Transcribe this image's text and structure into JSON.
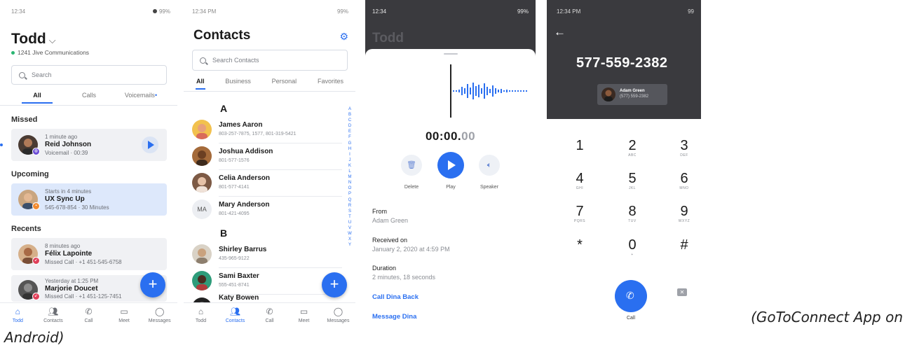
{
  "screen_home": {
    "status_time": "12:34",
    "status_right": "99%",
    "title": "Todd",
    "org": "1241 Jive Communications",
    "search_placeholder": "Search",
    "tabs": [
      "All",
      "Calls",
      "Voicemails"
    ],
    "voicemail_dot": "•",
    "missed_header": "Missed",
    "missed": {
      "time": "1 minute ago",
      "name": "Reid Johnson",
      "detail": "Voicemail · 00:39"
    },
    "upcoming_header": "Upcoming",
    "upcoming": {
      "time": "Starts in 4 minutes",
      "name": "UX Sync Up",
      "detail": "545-678-854 · 30 Minutes"
    },
    "recents_header": "Recents",
    "recents": [
      {
        "time": "8 minutes ago",
        "name": "Félix Lapointe",
        "detail": "Missed Call · +1 451-545-6758"
      },
      {
        "time": "Yesterday at 1:25 PM",
        "name": "Marjorie Doucet",
        "detail": "Missed Call · +1 451-125-7451"
      }
    ],
    "fab": "+",
    "nav": [
      "Todd",
      "Contacts",
      "Call",
      "Meet",
      "Messages"
    ]
  },
  "screen_contacts": {
    "status_time": "12:34 PM",
    "status_right": "99%",
    "title": "Contacts",
    "search_placeholder": "Search Contacts",
    "tabs": [
      "All",
      "Business",
      "Personal",
      "Favorites"
    ],
    "group_a": "A",
    "group_b": "B",
    "contacts_a": [
      {
        "name": "James Aaron",
        "phone": "803-257-7875, 1577, 801-319-5421"
      },
      {
        "name": "Joshua Addison",
        "phone": "801-577-1576"
      },
      {
        "name": "Celia Anderson",
        "phone": "801-577-4141"
      },
      {
        "name": "Mary Anderson",
        "phone": "801-421-4095",
        "initials": "MA"
      }
    ],
    "contacts_b": [
      {
        "name": "Shirley Barrus",
        "phone": "435-965-9122"
      },
      {
        "name": "Sami Baxter",
        "phone": "555-451-8741"
      },
      {
        "name": "Katy Bowen",
        "phone": ""
      }
    ],
    "alphabet": [
      "A",
      "B",
      "C",
      "D",
      "E",
      "F",
      "G",
      "H",
      "I",
      "J",
      "K",
      "L",
      "M",
      "N",
      "O",
      "P",
      "Q",
      "R",
      "S",
      "T",
      "U",
      "V",
      "W",
      "X",
      "Y"
    ],
    "fab": "+",
    "nav": [
      "Todd",
      "Contacts",
      "Call",
      "Meet",
      "Messages"
    ]
  },
  "screen_voicemail": {
    "status_time": "12:34",
    "status_right": "99%",
    "ghost_title": "Todd",
    "timer_main": "00:00.",
    "timer_dim": "00",
    "actions": [
      "Delete",
      "Play",
      "Speaker"
    ],
    "from_label": "From",
    "from_value": "Adam Green",
    "received_label": "Received on",
    "received_value": "January 2, 2020 at 4:59 PM",
    "duration_label": "Duration",
    "duration_value": "2 minutes, 18 seconds",
    "link_call": "Call Dina Back",
    "link_message": "Message Dina"
  },
  "screen_dialer": {
    "status_time": "12:34 PM",
    "status_right": "99",
    "number": "577-559-2382",
    "chip_name": "Adam Green",
    "chip_phone": "(577) 559-2382",
    "keys": [
      {
        "d": "1",
        "l": ""
      },
      {
        "d": "2",
        "l": "ABC"
      },
      {
        "d": "3",
        "l": "DEF"
      },
      {
        "d": "4",
        "l": "GHI"
      },
      {
        "d": "5",
        "l": "JKL"
      },
      {
        "d": "6",
        "l": "MNO"
      },
      {
        "d": "7",
        "l": "PQRS"
      },
      {
        "d": "8",
        "l": "TUV"
      },
      {
        "d": "9",
        "l": "WXYZ"
      },
      {
        "d": "*",
        "l": ""
      },
      {
        "d": "0",
        "l": "+"
      },
      {
        "d": "#",
        "l": ""
      }
    ],
    "call_label": "Call"
  },
  "caption_line1": "(GoToConnect App on",
  "caption_line2": "Android)",
  "colors": {
    "accent": "#2a6ff0",
    "dark_header": "#3a3a3e",
    "card": "#f0f1f4",
    "upcoming_card": "#dde8fb"
  }
}
